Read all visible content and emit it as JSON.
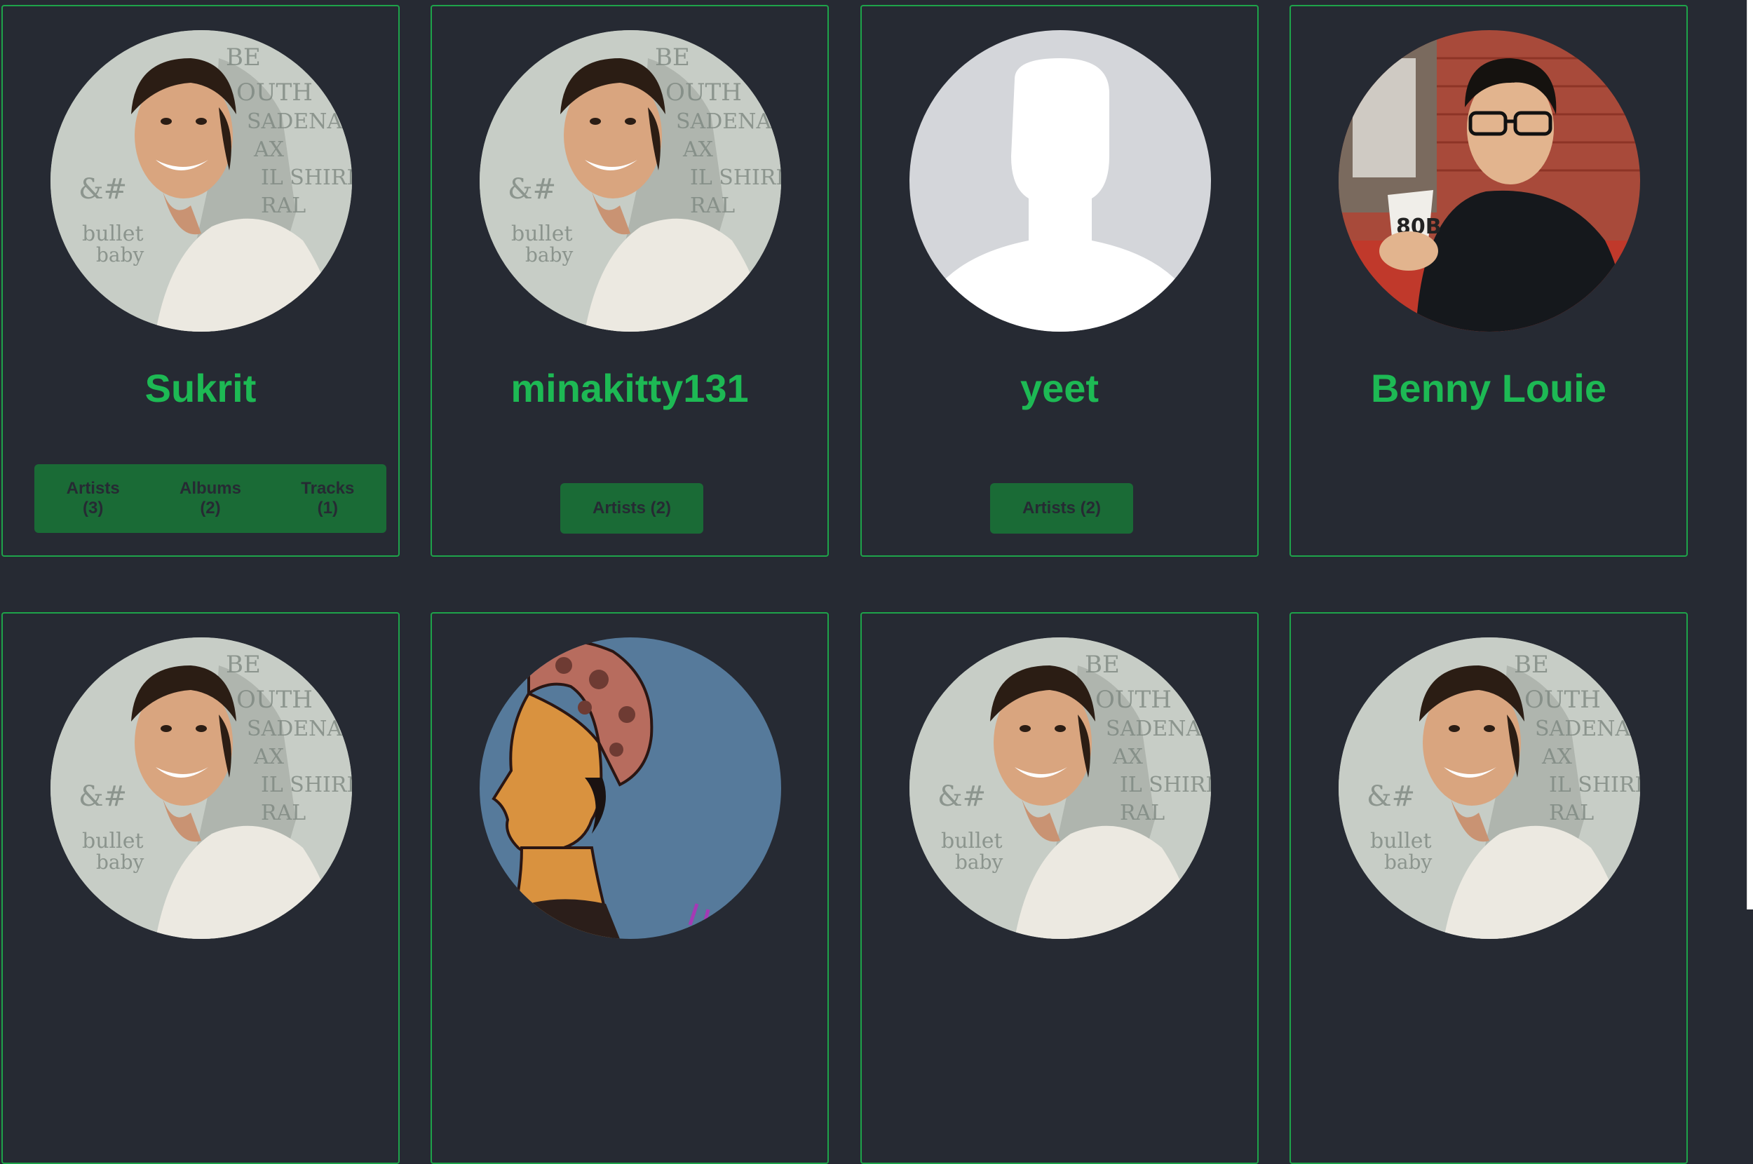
{
  "cards": [
    {
      "name": "Sukrit",
      "avatar": "tom-photo",
      "buttons": [
        {
          "label": "Artists",
          "count": "(3)"
        },
        {
          "label": "Albums",
          "count": "(2)"
        },
        {
          "label": "Tracks",
          "count": "(1)"
        }
      ]
    },
    {
      "name": "minakitty131",
      "avatar": "tom-photo",
      "buttons": [
        {
          "label": "Artists (2)"
        }
      ]
    },
    {
      "name": "yeet",
      "avatar": "default-silhouette",
      "buttons": [
        {
          "label": "Artists (2)"
        }
      ]
    },
    {
      "name": "Benny Louie",
      "avatar": "coffee-photo",
      "buttons": []
    },
    {
      "name": "",
      "avatar": "tom-photo"
    },
    {
      "name": "",
      "avatar": "illustration-woman"
    },
    {
      "name": "",
      "avatar": "tom-photo"
    },
    {
      "name": "",
      "avatar": "tom-photo"
    }
  ],
  "colors": {
    "background": "#262a33",
    "accent": "#1db954",
    "button": "#1a6b36",
    "border": "#1ea34a"
  }
}
